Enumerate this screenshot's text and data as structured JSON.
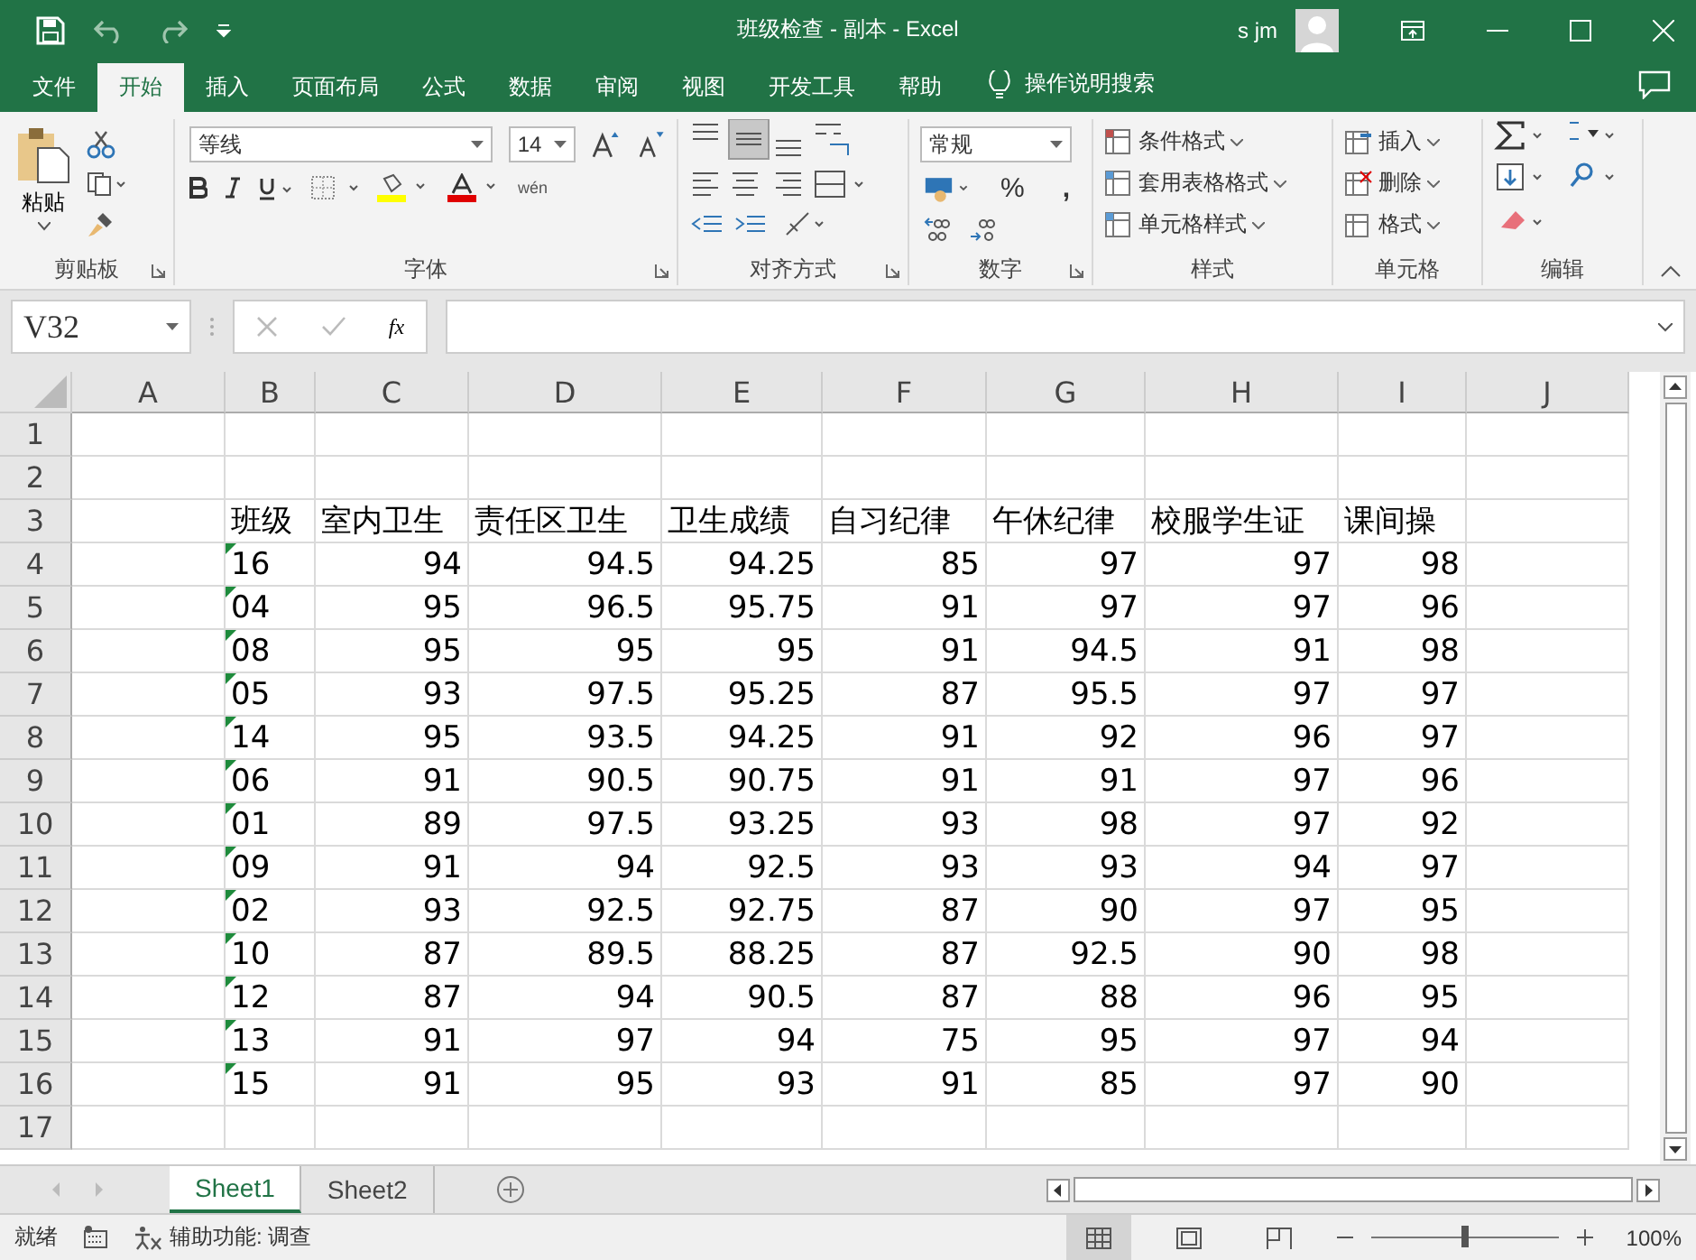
{
  "title_bar": {
    "title": "班级检查 - 副本  -  Excel",
    "user": "s jm"
  },
  "ribbon_tabs": [
    {
      "label": "文件",
      "selected": false
    },
    {
      "label": "开始",
      "selected": true
    },
    {
      "label": "插入",
      "selected": false
    },
    {
      "label": "页面布局",
      "selected": false
    },
    {
      "label": "公式",
      "selected": false
    },
    {
      "label": "数据",
      "selected": false
    },
    {
      "label": "审阅",
      "selected": false
    },
    {
      "label": "视图",
      "selected": false
    },
    {
      "label": "开发工具",
      "selected": false
    },
    {
      "label": "帮助",
      "selected": false
    }
  ],
  "tell_me": "操作说明搜索",
  "ribbon": {
    "clipboard": {
      "paste": "粘贴",
      "label": "剪贴板"
    },
    "font": {
      "name": "等线",
      "size": "14",
      "phonetic": "wén",
      "label": "字体"
    },
    "alignment": {
      "label": "对齐方式"
    },
    "number": {
      "format": "常规",
      "percent": "%",
      "comma": ",",
      "label": "数字"
    },
    "styles": {
      "items": [
        "条件格式",
        "套用表格格式",
        "单元格样式"
      ],
      "label": "样式"
    },
    "cells": {
      "items": [
        "插入",
        "删除",
        "格式"
      ],
      "label": "单元格"
    },
    "editing": {
      "label": "编辑"
    }
  },
  "formula_bar": {
    "name_box": "V32",
    "fx": "fx"
  },
  "columns": [
    "A",
    "B",
    "C",
    "D",
    "E",
    "F",
    "G",
    "H",
    "I",
    "J"
  ],
  "rows": [
    {
      "label": "1",
      "kind": "empty"
    },
    {
      "label": "2",
      "kind": "empty"
    },
    {
      "label": "3",
      "kind": "header",
      "cells": [
        "班级",
        "室内卫生",
        "责任区卫生",
        "卫生成绩",
        "自习纪律",
        "午休纪律",
        "校服学生证",
        "课间操"
      ]
    },
    {
      "label": "4",
      "kind": "data",
      "error_flag": true,
      "cells": [
        "16",
        "94",
        "94.5",
        "94.25",
        "85",
        "97",
        "97",
        "98"
      ]
    },
    {
      "label": "5",
      "kind": "data",
      "error_flag": true,
      "cells": [
        "04",
        "95",
        "96.5",
        "95.75",
        "91",
        "97",
        "97",
        "96"
      ]
    },
    {
      "label": "6",
      "kind": "data",
      "error_flag": true,
      "cells": [
        "08",
        "95",
        "95",
        "95",
        "91",
        "94.5",
        "91",
        "98"
      ]
    },
    {
      "label": "7",
      "kind": "data",
      "error_flag": true,
      "cells": [
        "05",
        "93",
        "97.5",
        "95.25",
        "87",
        "95.5",
        "97",
        "97"
      ]
    },
    {
      "label": "8",
      "kind": "data",
      "error_flag": true,
      "cells": [
        "14",
        "95",
        "93.5",
        "94.25",
        "91",
        "92",
        "96",
        "97"
      ]
    },
    {
      "label": "9",
      "kind": "data",
      "error_flag": true,
      "cells": [
        "06",
        "91",
        "90.5",
        "90.75",
        "91",
        "91",
        "97",
        "96"
      ]
    },
    {
      "label": "10",
      "kind": "data",
      "error_flag": true,
      "cells": [
        "01",
        "89",
        "97.5",
        "93.25",
        "93",
        "98",
        "97",
        "92"
      ]
    },
    {
      "label": "11",
      "kind": "data",
      "error_flag": true,
      "cells": [
        "09",
        "91",
        "94",
        "92.5",
        "93",
        "93",
        "94",
        "97"
      ]
    },
    {
      "label": "12",
      "kind": "data",
      "error_flag": true,
      "cells": [
        "02",
        "93",
        "92.5",
        "92.75",
        "87",
        "90",
        "97",
        "95"
      ]
    },
    {
      "label": "13",
      "kind": "data",
      "error_flag": true,
      "cells": [
        "10",
        "87",
        "89.5",
        "88.25",
        "87",
        "92.5",
        "90",
        "98"
      ]
    },
    {
      "label": "14",
      "kind": "data",
      "error_flag": true,
      "cells": [
        "12",
        "87",
        "94",
        "90.5",
        "87",
        "88",
        "96",
        "95"
      ]
    },
    {
      "label": "15",
      "kind": "data",
      "error_flag": true,
      "cells": [
        "13",
        "91",
        "97",
        "94",
        "75",
        "95",
        "97",
        "94"
      ]
    },
    {
      "label": "16",
      "kind": "data",
      "error_flag": true,
      "cells": [
        "15",
        "91",
        "95",
        "93",
        "91",
        "85",
        "97",
        "90"
      ]
    },
    {
      "label": "17",
      "kind": "empty"
    }
  ],
  "sheet_tabs": [
    {
      "label": "Sheet1",
      "selected": true
    },
    {
      "label": "Sheet2",
      "selected": false
    }
  ],
  "status_bar": {
    "state": "就绪",
    "accessibility": "辅助功能: 调查",
    "views": [
      {
        "kind": "normal",
        "selected": true
      },
      {
        "kind": "page_layout",
        "selected": false
      },
      {
        "kind": "page_break",
        "selected": false
      }
    ],
    "zoom_slider": {
      "level": 0.5
    },
    "zoom": "100%"
  }
}
